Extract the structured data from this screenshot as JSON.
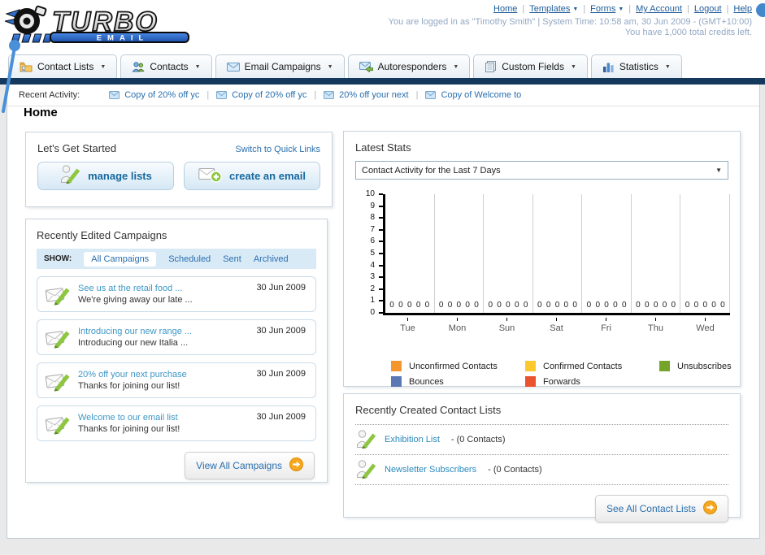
{
  "colors": {
    "navy_bar": "#15395c",
    "link_blue": "#1e5c9a",
    "status_text": "#93a7c3",
    "campaign_link": "#3e97c6",
    "panel_border": "#c9d3dd",
    "button_blue_text": "#17689e",
    "show_bar_bg": "#d9eaf7",
    "orange_arrow": "#f5a81f"
  },
  "header": {
    "logo_title": "TURBO",
    "logo_subtitle": "EMAIL",
    "links": [
      {
        "label": "Home"
      },
      {
        "label": "Templates",
        "dropdown": true
      },
      {
        "label": "Forms",
        "dropdown": true
      },
      {
        "label": "My Account"
      },
      {
        "label": "Logout"
      },
      {
        "label": "Help"
      }
    ],
    "status_line1": "You are logged in as \"Timothy Smith\" | System Time: 10:58 am, 30 Jun 2009 - (GMT+10:00)",
    "status_line2": "You have 1,000 total credits left."
  },
  "nav": {
    "tabs": [
      {
        "label": "Contact Lists",
        "icon": "contact-lists-icon"
      },
      {
        "label": "Contacts",
        "icon": "contacts-icon"
      },
      {
        "label": "Email Campaigns",
        "icon": "email-campaigns-icon"
      },
      {
        "label": "Autoresponders",
        "icon": "autoresponders-icon"
      },
      {
        "label": "Custom Fields",
        "icon": "custom-fields-icon"
      },
      {
        "label": "Statistics",
        "icon": "statistics-icon"
      }
    ]
  },
  "recent_activity": {
    "label": "Recent Activity:",
    "items": [
      "Copy of 20% off yc",
      "Copy of 20% off yc",
      "20% off your next",
      "Copy of Welcome to"
    ]
  },
  "page_title": "Home",
  "get_started": {
    "title": "Let's Get Started",
    "switch_link": "Switch to Quick Links",
    "manage_button": "manage lists",
    "create_button": "create an email"
  },
  "campaigns": {
    "title": "Recently Edited Campaigns",
    "show_label": "SHOW:",
    "tabs": [
      "All Campaigns",
      "Scheduled",
      "Sent",
      "Archived"
    ],
    "active_tab": "All Campaigns",
    "view_all": "View All Campaigns",
    "items": [
      {
        "title": "See us at the retail food ...",
        "subtitle": "We're giving away our late ...",
        "date": "30 Jun 2009"
      },
      {
        "title": "Introducing our new range ...",
        "subtitle": "Introducing our new Italia ...",
        "date": "30 Jun 2009"
      },
      {
        "title": "20% off your next purchase",
        "subtitle": "Thanks for joining our list!",
        "date": "30 Jun 2009"
      },
      {
        "title": "Welcome to our email list",
        "subtitle": "Thanks for joining our list!",
        "date": "30 Jun 2009"
      }
    ]
  },
  "latest_stats": {
    "title": "Latest Stats",
    "dropdown_value": "Contact Activity for the Last 7 Days"
  },
  "chart_data": {
    "type": "bar",
    "title": "Contact Activity for the Last 7 Days",
    "categories": [
      "Tue",
      "Mon",
      "Sun",
      "Sat",
      "Fri",
      "Thu",
      "Wed"
    ],
    "series": [
      {
        "name": "Unconfirmed Contacts",
        "color": "#f5952d",
        "values": [
          0,
          0,
          0,
          0,
          0,
          0,
          0
        ]
      },
      {
        "name": "Confirmed Contacts",
        "color": "#fbc92d",
        "values": [
          0,
          0,
          0,
          0,
          0,
          0,
          0
        ]
      },
      {
        "name": "Unsubscribes",
        "color": "#74a42a",
        "values": [
          0,
          0,
          0,
          0,
          0,
          0,
          0
        ]
      },
      {
        "name": "Bounces",
        "color": "#5a78b4",
        "values": [
          0,
          0,
          0,
          0,
          0,
          0,
          0
        ]
      },
      {
        "name": "Forwards",
        "color": "#e9542e",
        "values": [
          0,
          0,
          0,
          0,
          0,
          0,
          0
        ]
      }
    ],
    "ylim": [
      0,
      10
    ],
    "yticks": [
      0,
      1,
      2,
      3,
      4,
      5,
      6,
      7,
      8,
      9,
      10
    ],
    "value_labels": true,
    "grid": "vertical-group-separators",
    "legend_position": "bottom"
  },
  "contact_lists": {
    "title": "Recently Created Contact Lists",
    "see_all": "See All Contact Lists",
    "items": [
      {
        "name": "Exhibition List",
        "suffix": "- (0 Contacts)"
      },
      {
        "name": "Newsletter Subscribers",
        "suffix": "- (0 Contacts)"
      }
    ]
  }
}
